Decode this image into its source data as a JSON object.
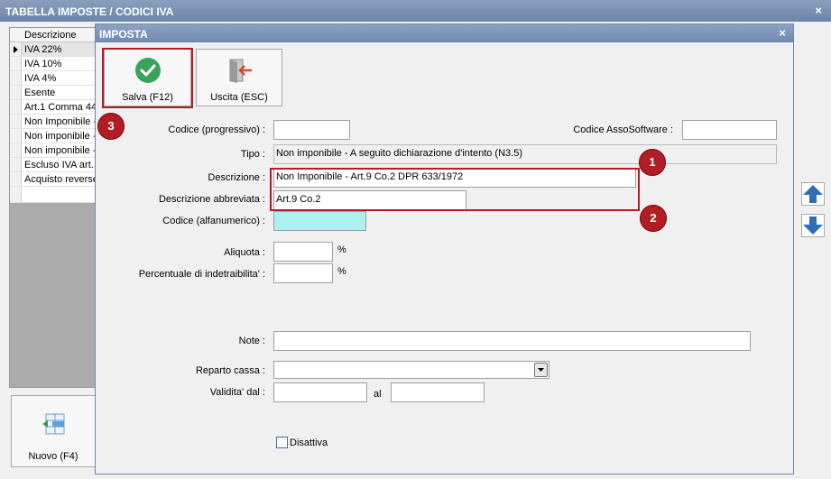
{
  "outer": {
    "title": "TABELLA IMPOSTE / CODICI IVA",
    "close": "×",
    "list_header": "Descrizione",
    "list_rows": [
      "IVA 22%",
      "IVA 10%",
      "IVA 4%",
      "Esente",
      "Art.1 Comma 44",
      "Non Imponibile -",
      "Non imponibile -",
      "Non imponibile -",
      "Escluso IVA art.",
      "Acquisto reverse"
    ],
    "new_button": "Nuovo (F4)"
  },
  "dialog": {
    "title": "IMPOSTA",
    "close": "×",
    "save_label": "Salva (F12)",
    "exit_label": "Uscita (ESC)",
    "codice_prog_label": "Codice (progressivo) :",
    "codice_prog_value": "",
    "asso_label": "Codice AssoSoftware :",
    "asso_value": "",
    "tipo_label": "Tipo :",
    "tipo_value": "Non imponibile - A seguito dichiarazione d'intento (N3.5)",
    "descr_label": "Descrizione :",
    "descr_value": "Non Imponibile - Art.9 Co.2 DPR 633/1972",
    "descr_abbr_label": "Descrizione abbreviata :",
    "descr_abbr_value": "Art.9 Co.2",
    "codice_alfa_label": "Codice (alfanumerico) :",
    "codice_alfa_value": "",
    "aliquota_label": "Aliquota :",
    "aliquota_value": "",
    "perc_label": "Percentuale di indetraibilita' :",
    "perc_value": "",
    "pct_symbol": "%",
    "note_label": "Note :",
    "note_value": "",
    "reparto_label": "Reparto cassa :",
    "reparto_value": "",
    "validita_label": "Validita' dal :",
    "al_label": "al",
    "validita_from": "",
    "validita_to": "",
    "disattiva_label": "Disattiva"
  },
  "annotations": [
    "1",
    "2",
    "3"
  ],
  "colors": {
    "accent_red": "#b01d25",
    "check_green": "#3aa35b",
    "arrow_blue": "#2f6fb5",
    "exit_red": "#d34a2a",
    "alfa_field": "#aef0f2"
  }
}
